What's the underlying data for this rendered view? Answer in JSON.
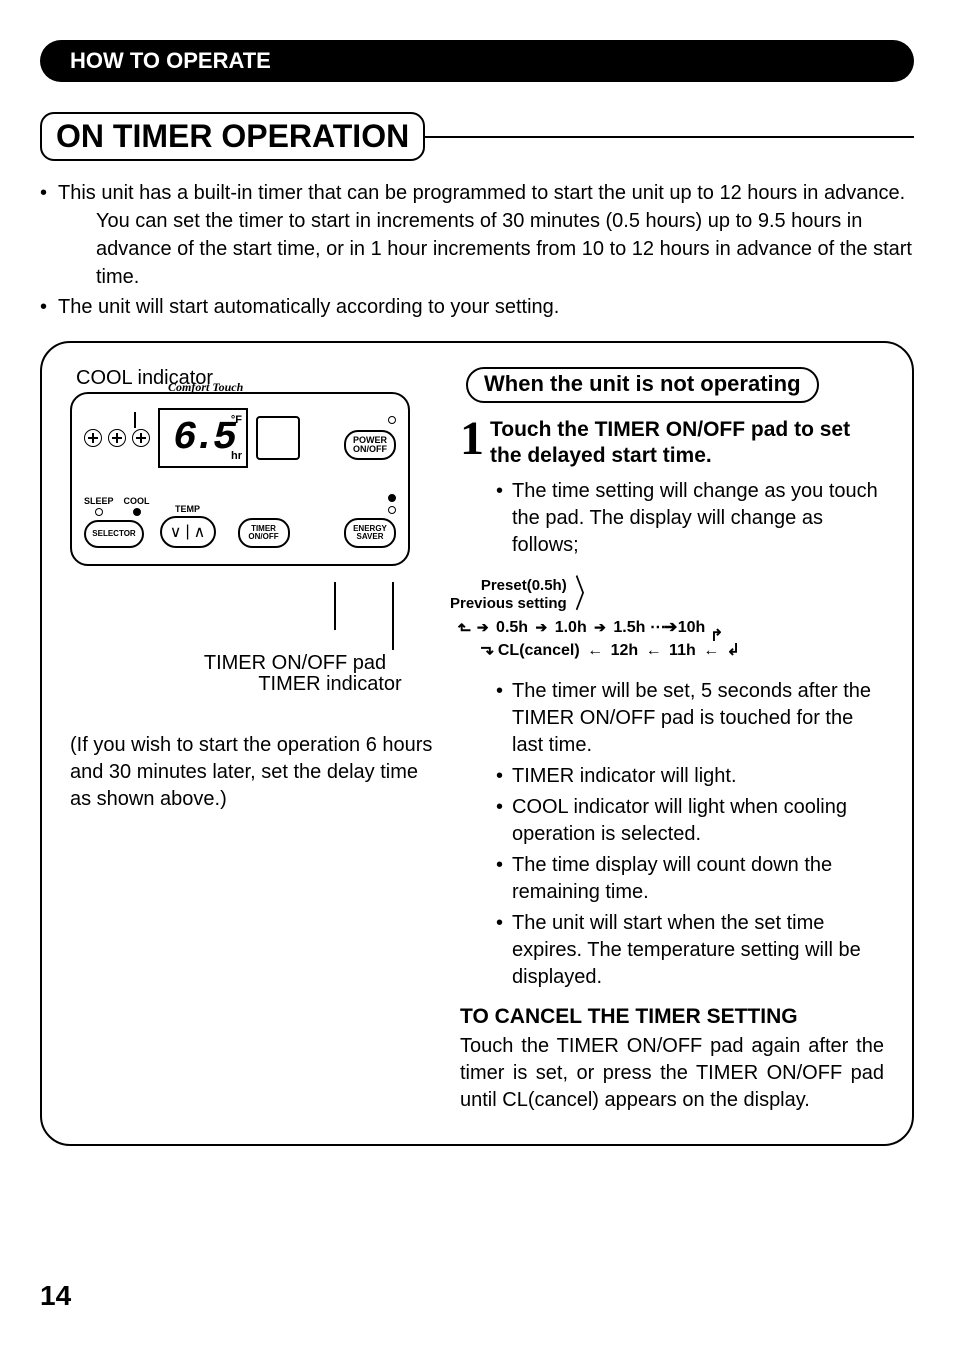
{
  "header": "HOW TO OPERATE",
  "main_title": "ON TIMER OPERATION",
  "intro": {
    "bullet1_line1": "This unit has a built-in timer that can be programmed to start the unit up to 12 hours in advance.",
    "bullet1_line2": "You can set the timer to start in increments of 30 minutes (0.5 hours) up to 9.5 hours in advance of the start time, or in 1 hour increments from 10 to 12 hours in advance of the start time.",
    "bullet2": "The unit will start automatically according to your setting."
  },
  "remote": {
    "cool_indicator_label": "COOL indicator",
    "brand": "Comfort Touch",
    "display_value": "6.5",
    "display_unit": "°F",
    "display_hr": "hr",
    "power_btn_l1": "POWER",
    "power_btn_l2": "ON/OFF",
    "sleep_label": "SLEEP",
    "cool_label": "COOL",
    "temp_label": "TEMP",
    "selector_label": "SELECTOR",
    "timer_btn_l1": "TIMER",
    "timer_btn_l2": "ON/OFF",
    "energy_btn_l1": "ENERGY",
    "energy_btn_l2": "SAVER",
    "timer_pad_callout": "TIMER ON/OFF pad",
    "timer_ind_callout": "TIMER indicator"
  },
  "example_note": "(If you wish to start the operation 6 hours and 30 minutes later, set the delay time as shown above.)",
  "subheading": "When the unit is not operating",
  "step1": {
    "num": "1",
    "title": "Touch the TIMER ON/OFF pad to set the delayed start time.",
    "pre_bullet": "The time setting will change as you touch the pad. The display will change as follows;",
    "flow_left_l1": "Preset(0.5h)",
    "flow_left_l2": "Previous setting",
    "flow_seq_top": [
      "0.5h",
      "1.0h",
      "1.5h",
      "10h"
    ],
    "flow_seq_bot_label": "CL(cancel)",
    "flow_seq_bot": [
      "12h",
      "11h"
    ],
    "bullets": [
      "The timer will be set, 5 seconds after the TIMER ON/OFF pad is touched for the last time.",
      "TIMER indicator will light.",
      "COOL indicator will light when cooling operation is selected.",
      "The time display will count down the remaining time.",
      "The unit will start when the set time expires. The temperature setting will be displayed."
    ]
  },
  "cancel": {
    "title": "TO CANCEL THE TIMER SETTING",
    "text": "Touch the TIMER ON/OFF pad again after the timer is set, or press the TIMER ON/OFF pad until CL(cancel) appears on the display."
  },
  "page_number": "14"
}
